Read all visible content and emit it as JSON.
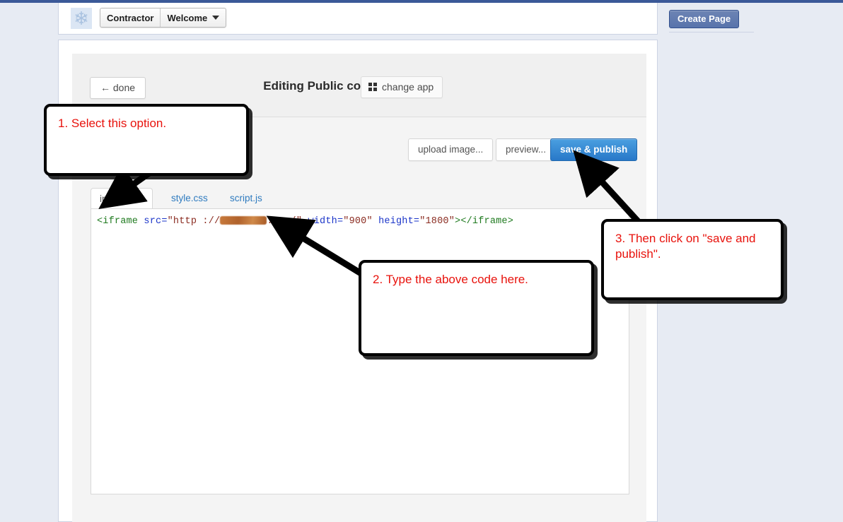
{
  "header": {
    "logo_icon": "snowflake-icon",
    "breadcrumb_site": "Contractor",
    "breadcrumb_page": "Welcome",
    "dropdown_icon": "chevron-down-icon",
    "create_page_label": "Create Page"
  },
  "app": {
    "done_label": "← done",
    "title": "Editing Public content",
    "change_app_label": "change app",
    "change_app_icon": "grid-icon"
  },
  "toolbar": {
    "upload_label": "upload image...",
    "preview_label": "preview...",
    "save_label": "save & publish",
    "save_color": "#2878c8"
  },
  "tabs": [
    {
      "label": "index.html",
      "active": true
    },
    {
      "label": "style.css",
      "active": false
    },
    {
      "label": "script.js",
      "active": false
    }
  ],
  "code": {
    "tag_open": "<iframe",
    "attr_src": " src=",
    "val_src_prefix": "\"http ://",
    "redacted": "[redacted-domain]",
    "val_src_suffix": ".com/\"",
    "attr_width": " width=",
    "val_width": "\"900\"",
    "attr_height": " height=",
    "val_height": "\"1800\"",
    "tag_close": "></iframe>",
    "color_tag": "#1f7a1f",
    "color_attr": "#1b35c9",
    "color_value": "#8a2b20"
  },
  "annotations": [
    {
      "id": 1,
      "text": "1. Select this option.",
      "color": "#e8120c"
    },
    {
      "id": 2,
      "text": "2. Type the above code here.",
      "color": "#e8120c"
    },
    {
      "id": 3,
      "text": "3. Then click on \"save and publish\".",
      "color": "#e8120c"
    }
  ]
}
